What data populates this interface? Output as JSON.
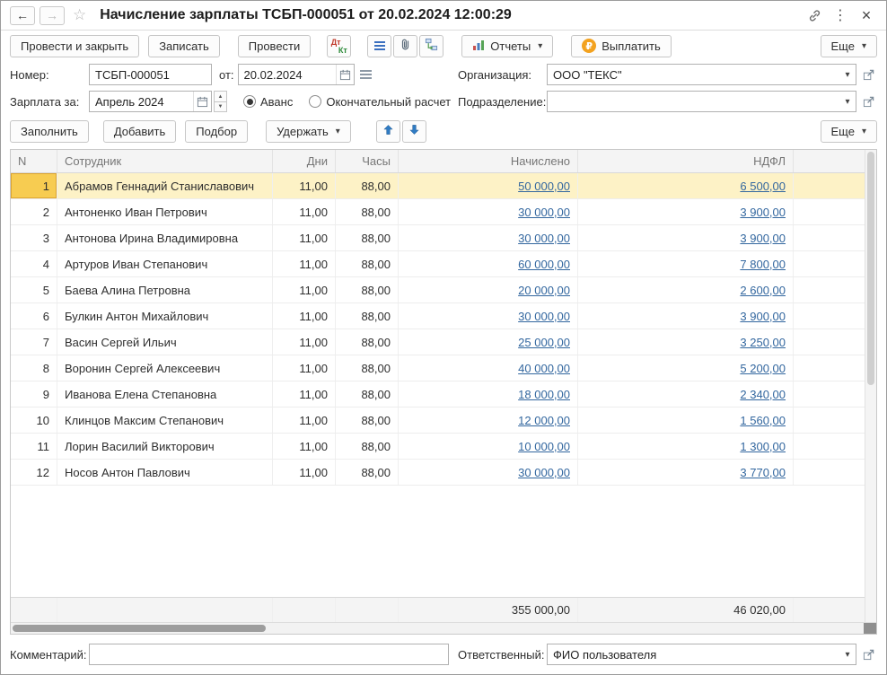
{
  "window": {
    "title": "Начисление зарплаты ТСБП-000051 от 20.02.2024 12:00:29"
  },
  "icons": {
    "back": "←",
    "forward": "→",
    "star": "☆",
    "menu": "⋮",
    "close": "×",
    "dropdown": "▾",
    "spin_up": "▲",
    "spin_down": "▼"
  },
  "toolbar": {
    "post_and_close": "Провести и закрыть",
    "save": "Записать",
    "post": "Провести",
    "dt": "Дт",
    "kt": "Кт",
    "reports": "Отчеты",
    "pay": "Выплатить",
    "ruble": "₽",
    "more": "Еще"
  },
  "form": {
    "number_label": "Номер:",
    "number_value": "ТСБП-000051",
    "date_label": "от:",
    "date_value": "20.02.2024",
    "organization_label": "Организация:",
    "organization_value": "ООО \"ТЕКС\"",
    "salary_period_label": "Зарплата за:",
    "salary_period_value": "Апрель 2024",
    "advance_option": "Аванс",
    "final_option": "Окончательный расчет",
    "department_label": "Подразделение:",
    "department_value": ""
  },
  "table_toolbar": {
    "fill": "Заполнить",
    "add": "Добавить",
    "pick": "Подбор",
    "withhold": "Удержать",
    "more": "Еще"
  },
  "table": {
    "selected_index": 0,
    "columns": {
      "n": "N",
      "employee": "Сотрудник",
      "days": "Дни",
      "hours": "Часы",
      "accrued": "Начислено",
      "ndfl": "НДФЛ"
    },
    "rows": [
      {
        "n": "1",
        "employee": "Абрамов Геннадий Станиславович",
        "days": "11,00",
        "hours": "88,00",
        "accrued": "50 000,00",
        "ndfl": "6 500,00"
      },
      {
        "n": "2",
        "employee": "Антоненко Иван Петрович",
        "days": "11,00",
        "hours": "88,00",
        "accrued": "30 000,00",
        "ndfl": "3 900,00"
      },
      {
        "n": "3",
        "employee": "Антонова Ирина Владимировна",
        "days": "11,00",
        "hours": "88,00",
        "accrued": "30 000,00",
        "ndfl": "3 900,00"
      },
      {
        "n": "4",
        "employee": "Артуров Иван Степанович",
        "days": "11,00",
        "hours": "88,00",
        "accrued": "60 000,00",
        "ndfl": "7 800,00"
      },
      {
        "n": "5",
        "employee": "Баева Алина Петровна",
        "days": "11,00",
        "hours": "88,00",
        "accrued": "20 000,00",
        "ndfl": "2 600,00"
      },
      {
        "n": "6",
        "employee": "Булкин Антон Михайлович",
        "days": "11,00",
        "hours": "88,00",
        "accrued": "30 000,00",
        "ndfl": "3 900,00"
      },
      {
        "n": "7",
        "employee": "Васин Сергей Ильич",
        "days": "11,00",
        "hours": "88,00",
        "accrued": "25 000,00",
        "ndfl": "3 250,00"
      },
      {
        "n": "8",
        "employee": "Воронин Сергей Алексеевич",
        "days": "11,00",
        "hours": "88,00",
        "accrued": "40 000,00",
        "ndfl": "5 200,00"
      },
      {
        "n": "9",
        "employee": "Иванова Елена Степановна",
        "days": "11,00",
        "hours": "88,00",
        "accrued": "18 000,00",
        "ndfl": "2 340,00"
      },
      {
        "n": "10",
        "employee": "Клинцов Максим Степанович",
        "days": "11,00",
        "hours": "88,00",
        "accrued": "12 000,00",
        "ndfl": "1 560,00"
      },
      {
        "n": "11",
        "employee": "Лорин Василий Викторович",
        "days": "11,00",
        "hours": "88,00",
        "accrued": "10 000,00",
        "ndfl": "1 300,00"
      },
      {
        "n": "12",
        "employee": "Носов Антон Павлович",
        "days": "11,00",
        "hours": "88,00",
        "accrued": "30 000,00",
        "ndfl": "3 770,00"
      }
    ],
    "totals": {
      "accrued": "355 000,00",
      "ndfl": "46 020,00"
    }
  },
  "footer": {
    "comment_label": "Комментарий:",
    "comment_value": "",
    "responsible_label": "Ответственный:",
    "responsible_value": "ФИО пользователя"
  }
}
